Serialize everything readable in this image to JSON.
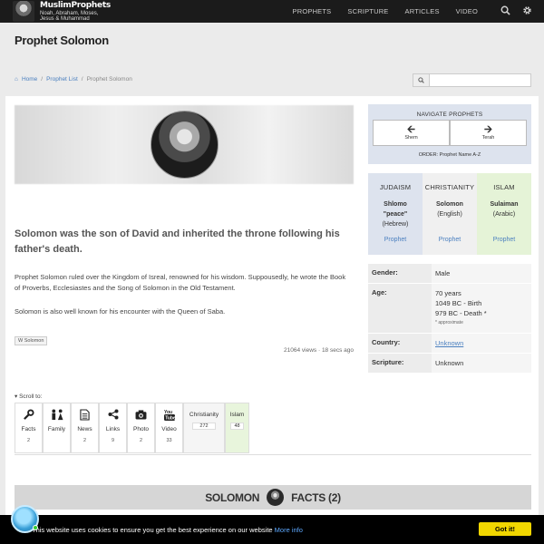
{
  "header": {
    "logo_title": "MuslimProphets",
    "logo_subtitle_1": "Noah, Abraham, Moses,",
    "logo_subtitle_2": "Jesus & Muhammad",
    "nav": [
      "PROPHETS",
      "SCRIPTURE",
      "ARTICLES",
      "VIDEO"
    ],
    "search_icon": "search-icon",
    "settings_icon": "gear-icon"
  },
  "page": {
    "title": "Prophet Solomon"
  },
  "breadcrumb": {
    "home": "Home",
    "list": "Prophet List",
    "current": "Prophet Solomon"
  },
  "search": {
    "placeholder": ""
  },
  "article": {
    "lead": "Solomon was the son of David and inherited the throne following his father's death.",
    "para1": "Prophet Solomon ruled over the Kingdom of Isreal, renowned for his wisdom. Suppousedly, he wrote the Book of Proverbs, Ecclesiastes and the Song of Solomon in the Old Testament.",
    "para2": "Solomon is also well known for his encounter with the Queen of Saba.",
    "tag": "W Solomon",
    "views": "21064 views · 18 secs ago"
  },
  "scroll_to": {
    "label": "Scroll to:",
    "tabs": [
      {
        "label": "Facts",
        "count": "2",
        "icon": "wrench-icon"
      },
      {
        "label": "Family",
        "count": "",
        "icon": "family-icon"
      },
      {
        "label": "News",
        "count": "2",
        "icon": "news-icon"
      },
      {
        "label": "Links",
        "count": "9",
        "icon": "share-icon"
      },
      {
        "label": "Photo",
        "count": "2",
        "icon": "camera-icon"
      },
      {
        "label": "Video",
        "count": "33",
        "icon": "youtube-icon"
      }
    ],
    "religions": [
      {
        "label": "Christianity",
        "count": "272"
      },
      {
        "label": "Islam",
        "count": "48"
      }
    ]
  },
  "facts_bar": {
    "left": "SOLOMON",
    "right": "FACTS (2)"
  },
  "navigate": {
    "title": "NAVIGATE PROPHETS",
    "prev": "Shem",
    "next": "Terah",
    "order": "ORDER: Prophet Name A-Z"
  },
  "religions": [
    {
      "head": "JUDAISM",
      "name_1": "Shlomo",
      "name_2": "\"peace\"",
      "lang": "(Hebrew)",
      "link": "Prophet"
    },
    {
      "head": "CHRISTIANITY",
      "name_1": "Solomon",
      "name_2": "",
      "lang": "(English)",
      "link": "Prophet"
    },
    {
      "head": "ISLAM",
      "name_1": "Sulaiman",
      "name_2": "",
      "lang": "(Arabic)",
      "link": "Prophet"
    }
  ],
  "info": {
    "gender_key": "Gender:",
    "gender_val": "Male",
    "age_key": "Age:",
    "age_val": "70 years",
    "birth": "1049 BC - Birth",
    "death": "979 BC - Death *",
    "approx": "* approximate",
    "country_key": "Country:",
    "country_val": "Unknown",
    "scripture_key": "Scripture:",
    "scripture_val": "Unknown"
  },
  "cookie": {
    "text": "This website uses cookies to ensure you get the best experience on our website",
    "more": "More info",
    "button": "Got it!"
  },
  "colors": {
    "nav_bg": "#1b1b1b",
    "link": "#4a7fbf",
    "judaism_bg": "#dde3ee",
    "islam_bg": "#e5f3d7",
    "cookie_button": "#f1d600"
  }
}
